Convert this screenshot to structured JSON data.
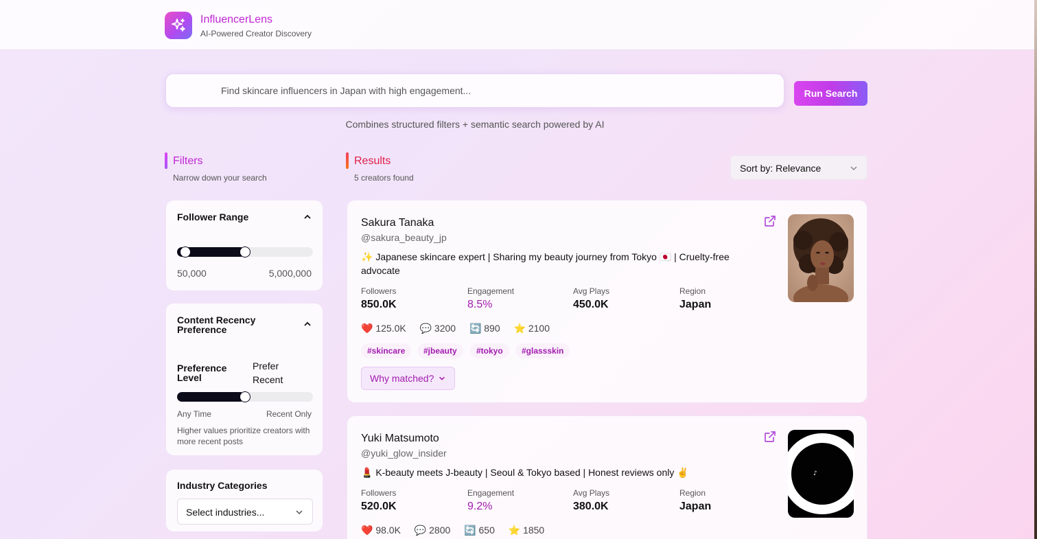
{
  "header": {
    "brand_name": "InfluencerLens",
    "brand_subtitle": "AI-Powered Creator Discovery"
  },
  "search": {
    "placeholder": "Find skincare influencers in Japan with high engagement...",
    "button_label": "Run Search",
    "hint": "Combines structured filters + semantic search powered by AI"
  },
  "filters": {
    "title": "Filters",
    "subtitle": "Narrow down your search",
    "follower_range": {
      "title": "Follower Range",
      "min_label": "50,000",
      "max_label": "5,000,000",
      "low_fraction": 0.04,
      "high_fraction": 0.5
    },
    "recency": {
      "title": "Content Recency Preference",
      "level_label": "Preference Level",
      "level_value": "Prefer Recent",
      "left_label": "Any Time",
      "right_label": "Recent Only",
      "fraction": 0.5,
      "help": "Higher values prioritize creators with more recent posts"
    },
    "industry": {
      "title": "Industry Categories",
      "placeholder": "Select industries..."
    }
  },
  "results": {
    "title": "Results",
    "count": "5 creators found",
    "sort_label": "Sort by: Relevance",
    "creators": [
      {
        "name": "Sakura Tanaka",
        "handle": "@sakura_beauty_jp",
        "bio": "✨ Japanese skincare expert | Sharing my beauty journey from Tokyo 🇯🇵 | Cruelty-free advocate",
        "followers_label": "Followers",
        "followers": "850.0K",
        "engagement_label": "Engagement",
        "engagement": "8.5%",
        "avg_plays_label": "Avg Plays",
        "avg_plays": "450.0K",
        "region_label": "Region",
        "region": "Japan",
        "likes": "❤️ 125.0K",
        "comments": "💬 3200",
        "shares": "🔄 890",
        "saves": "⭐ 2100",
        "tags": [
          "#skincare",
          "#jbeauty",
          "#tokyo",
          "#glassskin"
        ],
        "why_label": "Why matched?"
      },
      {
        "name": "Yuki Matsumoto",
        "handle": "@yuki_glow_insider",
        "bio": "💄 K-beauty meets J-beauty | Seoul & Tokyo based | Honest reviews only ✌️",
        "followers_label": "Followers",
        "followers": "520.0K",
        "engagement_label": "Engagement",
        "engagement": "9.2%",
        "avg_plays_label": "Avg Plays",
        "avg_plays": "380.0K",
        "region_label": "Region",
        "region": "Japan",
        "likes": "❤️ 98.0K",
        "comments": "💬 2800",
        "shares": "🔄 650",
        "saves": "⭐ 1850"
      }
    ]
  },
  "colors": {
    "accent": "#c026d3",
    "engagement": "#a21caf",
    "results_bar": "#f43f5e"
  }
}
